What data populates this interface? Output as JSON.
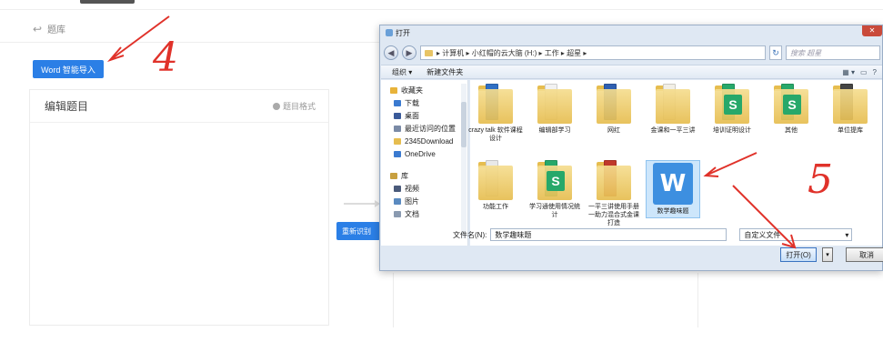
{
  "app": {
    "back_label": "题库",
    "word_import_button": "Word 智能导入",
    "editor_panel_title": "编辑题目",
    "format_hint": "题目格式",
    "recognize_button": "重新识别"
  },
  "annotations": {
    "step_a": "4",
    "step_b": "5"
  },
  "dialog": {
    "title": "打开",
    "address_path": "▸ 计算机 ▸ 小红帽的云大脑 (H:) ▸ 工作 ▸ 超星 ▸",
    "search_placeholder": "搜索 超星",
    "toolbar": {
      "organize": "组织 ▾",
      "new_folder": "新建文件夹"
    },
    "nav_items": [
      {
        "label": "收藏夹",
        "icon": "star-icon",
        "color": "#e8b33a"
      },
      {
        "label": "下载",
        "icon": "download-folder-icon",
        "color": "#3a7ad0"
      },
      {
        "label": "桌面",
        "icon": "desktop-icon",
        "color": "#3a5a9a"
      },
      {
        "label": "最近访问的位置",
        "icon": "recent-places-icon",
        "color": "#7a8aa6"
      },
      {
        "label": "2345Download",
        "icon": "folder-icon",
        "color": "#e6bd4f"
      },
      {
        "label": "OneDrive",
        "icon": "cloud-icon",
        "color": "#3a7ad0"
      }
    ],
    "library_items": [
      {
        "label": "库",
        "icon": "library-icon",
        "color": "#c8a040"
      },
      {
        "label": "视频",
        "icon": "video-icon",
        "color": "#4a5a7a"
      },
      {
        "label": "图片",
        "icon": "picture-icon",
        "color": "#5a8ac0"
      },
      {
        "label": "文档",
        "icon": "document-icon",
        "color": "#8a9ab0"
      }
    ],
    "files": [
      {
        "name": "crazy talk 软件课程设计",
        "accent": "#2f6fc4"
      },
      {
        "name": "编辑部学习",
        "accent": "#f2f2f2"
      },
      {
        "name": "网红",
        "accent": "#2f5fb0"
      },
      {
        "name": "金课和一平三讲",
        "accent": "#f2efe6"
      },
      {
        "name": "培训证明设计",
        "accent": "#27a86a"
      },
      {
        "name": "其他",
        "accent": "#27a86a"
      },
      {
        "name": "单位提库",
        "accent": "#444444"
      },
      {
        "name": "功能工作",
        "accent": "#e9e9e9"
      },
      {
        "name": "学习通使用情况统计",
        "accent": "#27a86a"
      },
      {
        "name": "一平三讲使用手册一助力混合式金课打造",
        "accent": "#c0392b"
      },
      {
        "name": "数学趣味题",
        "accent": "#3d8fe0"
      }
    ],
    "wps_glyph": "W",
    "wps_letter_s": "S",
    "filename_label": "文件名(N):",
    "filename_value": "数学趣味题",
    "filter_value": "自定义文件",
    "open_button": "打开(O)",
    "cancel_button": "取消"
  }
}
